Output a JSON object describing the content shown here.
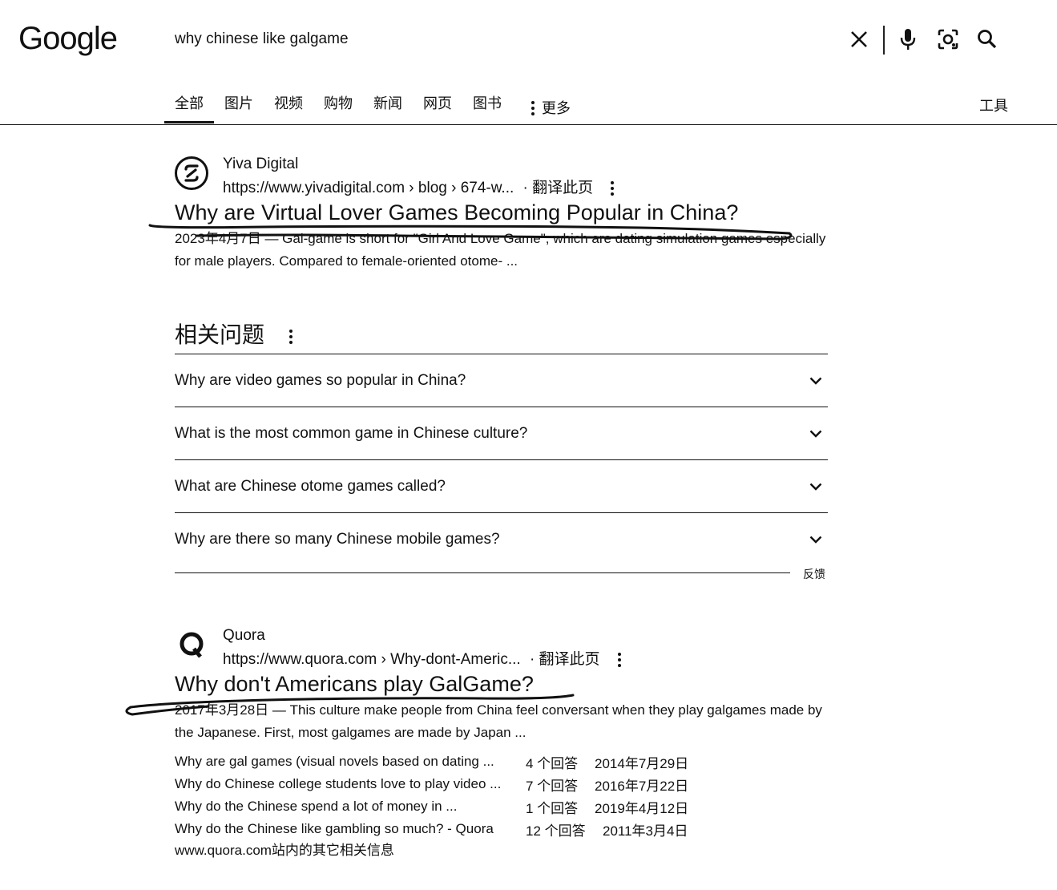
{
  "header": {
    "logo_text": "Google",
    "search_query": "why chinese like galgame",
    "icons": [
      "close-icon",
      "mic-icon",
      "lens-icon",
      "search-icon"
    ]
  },
  "tabs": [
    {
      "label": "全部",
      "active": true
    },
    {
      "label": "图片"
    },
    {
      "label": "视频"
    },
    {
      "label": "购物"
    },
    {
      "label": "新闻"
    },
    {
      "label": "网页"
    },
    {
      "label": "图书"
    },
    {
      "label": "更多"
    }
  ],
  "tools_label": "工具",
  "results": [
    {
      "site_name": "Yiva Digital",
      "url": "https://www.yivadigital.com › blog › 674-w...",
      "translate": "· 翻译此页",
      "title": "Why are Virtual Lover Games Becoming Popular in China?",
      "snippet": "2023年4月7日 — Gal-game is short for \"Girl And Love Game\", which are dating simulation games especially for male players. Compared to female-oriented otome- ..."
    },
    {
      "site_name": "Quora",
      "url": "https://www.quora.com › Why-dont-Americ...",
      "translate": "· 翻译此页",
      "title": "Why don't Americans play GalGame?",
      "snippet": "2017年3月28日 — This culture make people from China feel conversant when they play galgames made by the Japanese. First, most galgames are made by Japan ..."
    }
  ],
  "paa": {
    "title": "相关问题",
    "questions": [
      "Why are video games so popular in China?",
      "What is the most common game in Chinese culture?",
      "What are Chinese otome games called?",
      "Why are there so many Chinese mobile games?"
    ],
    "feedback": "反馈"
  },
  "sublinks": [
    {
      "q": "Why are gal games (visual novels based on dating ...",
      "count": "4 个回答",
      "date": "2014年7月29日"
    },
    {
      "q": "Why do Chinese college students love to play video ...",
      "count": "7 个回答",
      "date": "2016年7月22日"
    },
    {
      "q": "Why do the Chinese spend a lot of money in ...",
      "count": "1 个回答",
      "date": "2019年4月12日"
    },
    {
      "q": "Why do the Chinese like gambling so much? - Quora",
      "count": "12 个回答",
      "date": "2011年3月4日"
    }
  ],
  "more_info": "www.quora.com站内的其它相关信息"
}
